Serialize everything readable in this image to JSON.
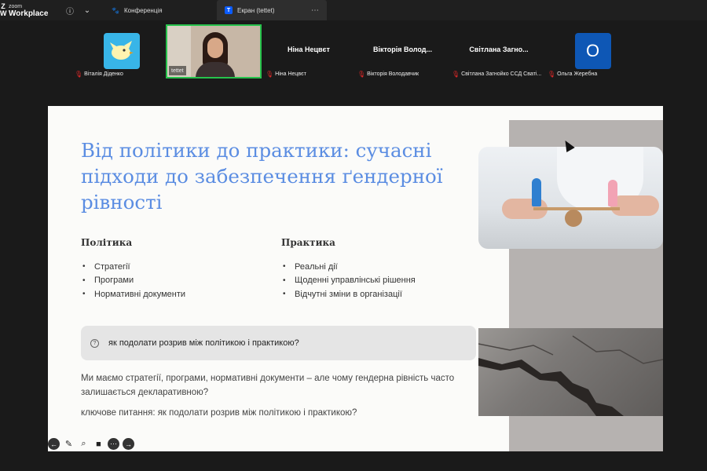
{
  "app": {
    "logo_mark": "Z\nW",
    "logo_small": "zoom",
    "logo_big": "Workplace"
  },
  "tabs": {
    "conference": "Конференція",
    "screen": "Екран (tettet)",
    "screen_badge": "T"
  },
  "participants": [
    {
      "nameplate": "Віталія Діденко",
      "muted": true,
      "type": "avatar-bird"
    },
    {
      "nameplate": "tettet",
      "muted": false,
      "type": "video"
    },
    {
      "display_name": "Ніна Нецвєт",
      "nameplate": "Ніна Нецвєт",
      "muted": true,
      "type": "name"
    },
    {
      "display_name": "Вікторія  Волод...",
      "nameplate": "Вікторія Володавчик",
      "muted": true,
      "type": "name"
    },
    {
      "display_name": "Світлана  Загно...",
      "nameplate": "Світлана Загнойко ССД Сваті...",
      "muted": true,
      "type": "name"
    },
    {
      "avatar_letter": "O",
      "nameplate": "Ольга Жеребна",
      "muted": true,
      "type": "avatar-letter"
    }
  ],
  "slide": {
    "title": "Від політики до практики: сучасні підходи до забезпечення ґендерної рівності",
    "col1_head": "Політика",
    "col1_items": [
      "Стратегії",
      "Програми",
      "Нормативні документи"
    ],
    "col2_head": "Практика",
    "col2_items": [
      "Реальні дії",
      "Щоденні управлінські рішення",
      "Відчутні зміни в організації"
    ],
    "callout_icon": "?",
    "callout": "як подолати розрив між політикою і практикою?",
    "body1": "Ми маємо стратегії, програми, нормативні документи – але чому гендерна рівність часто залишається декларативною?",
    "body2": "ключове питання: як подолати розрив між політикою і практикою?"
  },
  "icons": {
    "info": "info-icon",
    "chevron": "chevron-down-icon",
    "paw": "paw-icon",
    "more": "more-icon",
    "mic_off": "mic-off-icon"
  },
  "colors": {
    "title_blue": "#5b8de2",
    "active_speaker": "#27c24c",
    "zoom_blue": "#0b5cff"
  }
}
